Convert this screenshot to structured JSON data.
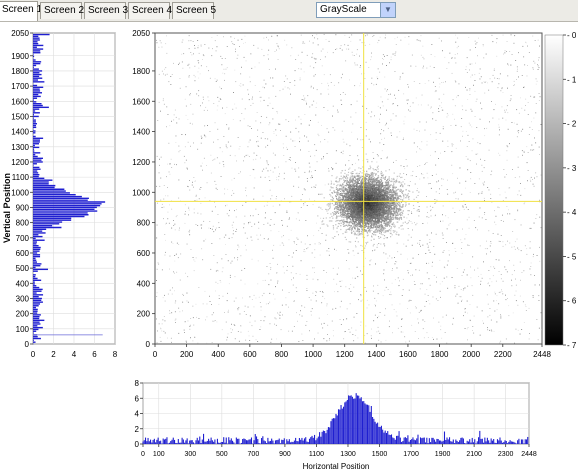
{
  "tabs": [
    "Screen 1",
    "Screen 2",
    "Screen 3",
    "Screen 4",
    "Screen 5"
  ],
  "colormap_select": {
    "value": "GrayScale"
  },
  "plots": {
    "vertical_profile": {
      "ylabel": "Vertical Position",
      "y_ticks": [
        0,
        100,
        200,
        300,
        400,
        500,
        600,
        700,
        800,
        900,
        1000,
        1100,
        1200,
        1300,
        1400,
        1500,
        1600,
        1700,
        1800,
        1900,
        2050
      ],
      "x_ticks": [
        0,
        2,
        4,
        6,
        8
      ],
      "color": "#1f1fd0"
    },
    "image": {
      "x_ticks": [
        0,
        200,
        400,
        600,
        800,
        1000,
        1200,
        1400,
        1600,
        1800,
        2000,
        2200,
        2448
      ],
      "y_ticks": [
        0,
        200,
        400,
        600,
        800,
        1000,
        1200,
        1400,
        1600,
        1800,
        2050
      ],
      "crosshair": {
        "x": 1320,
        "y": 940
      },
      "crosshair_color": "#f0e040",
      "colorbar_ticks": [
        0,
        1,
        2,
        3,
        4,
        5,
        6,
        7
      ]
    },
    "horizontal_profile": {
      "xlabel": "Horizontal Position",
      "x_ticks": [
        0,
        100,
        300,
        500,
        700,
        900,
        1100,
        1300,
        1500,
        1700,
        1900,
        2100,
        2300,
        2448
      ],
      "y_ticks": [
        0,
        2,
        4,
        6,
        8
      ],
      "color": "#1f1fd0"
    }
  }
}
